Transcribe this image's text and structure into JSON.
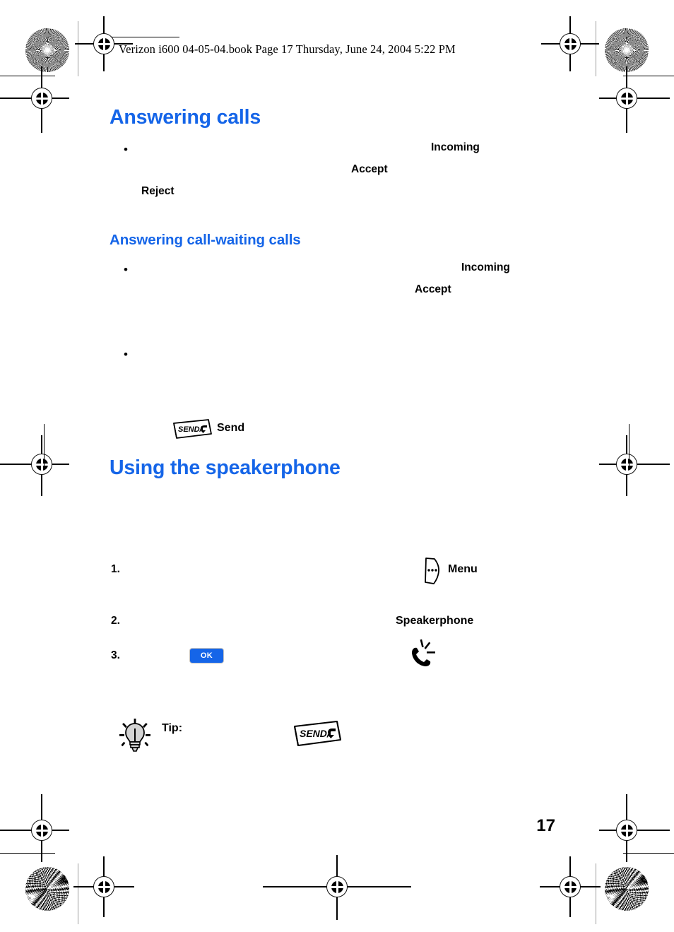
{
  "document": {
    "running_header": "Verizon i600 04-05-04.book  Page 17  Thursday, June 24, 2004  5:22 PM",
    "page_number": "17",
    "heading_color": "#1565e8"
  },
  "sections": {
    "answering_calls": {
      "heading": "Answering calls",
      "bullet_marker": "•",
      "keywords": {
        "incoming": "Incoming",
        "accept": "Accept",
        "reject": "Reject"
      }
    },
    "call_waiting": {
      "heading": "Answering call-waiting calls",
      "bullet_marker": "•",
      "keywords": {
        "incoming": "Incoming",
        "accept": "Accept"
      },
      "send_key_label": "Send"
    },
    "speakerphone": {
      "heading": "Using the speakerphone",
      "steps": [
        {
          "number": "1.",
          "keyword": "Menu"
        },
        {
          "number": "2.",
          "keyword": "Speakerphone"
        },
        {
          "number": "3.",
          "keyword": ""
        }
      ],
      "ok_key_label": "OK",
      "tip_label": "Tip:"
    }
  },
  "icons": {
    "send_key": "send-key-icon",
    "send_key_text": "SEND/",
    "menu_key": "menu-key-icon",
    "ok_key": "ok-key-icon",
    "speakerphone_indicator": "speakerphone-icon",
    "tip_bulb": "lightbulb-icon"
  },
  "printer_marks": {
    "registration_target": "registration-target-icon",
    "starburst_target": "starburst-target-icon",
    "moire_target": "moire-target-icon"
  }
}
